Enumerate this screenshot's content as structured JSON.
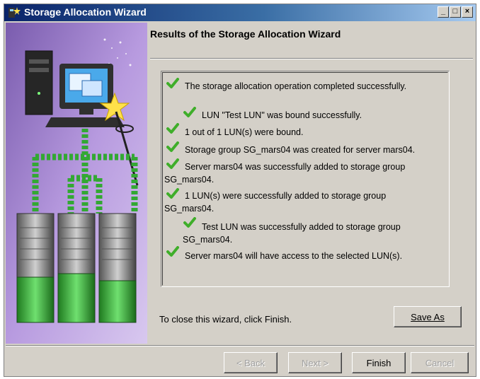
{
  "window": {
    "title": "Storage Allocation Wizard",
    "controls": {
      "minimize": "_",
      "maximize": "□",
      "close": "×"
    }
  },
  "header": {
    "title": "Results of the Storage Allocation Wizard"
  },
  "results": [
    "The storage allocation operation completed successfully.",
    "LUN \"Test LUN\" was bound successfully.",
    "1 out of 1 LUN(s) were bound.",
    "Storage group SG_mars04 was created for server mars04.",
    "Server mars04 was successfully added to storage group",
    "SG_mars04.",
    "1 LUN(s) were successfully added to storage group",
    "SG_mars04.",
    "Test LUN was successfully added to storage group",
    "SG_mars04.",
    "Server mars04 will have access to the selected LUN(s)."
  ],
  "footer": {
    "close_text": "To close this wizard, click Finish."
  },
  "buttons": {
    "save_as": "Save As",
    "back": "< Back",
    "next": "Next >",
    "finish": "Finish",
    "cancel": "Cancel"
  },
  "colors": {
    "check": "#3fae2a",
    "title_start": "#0a246a",
    "title_end": "#a6caf0",
    "panel_bg": "#a98bd0"
  },
  "icons": [
    "wizard-app-icon",
    "check-icon"
  ]
}
